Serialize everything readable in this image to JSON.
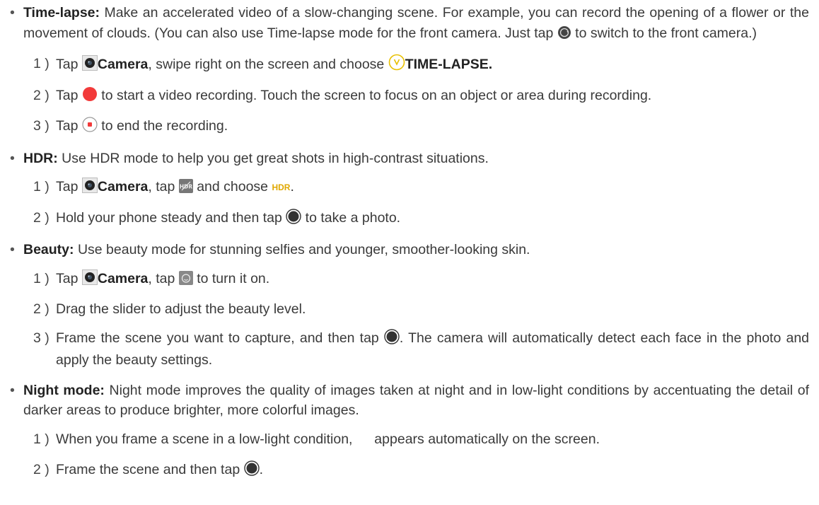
{
  "timelapse": {
    "lead": "Time-lapse:",
    "desc_1": " Make an accelerated video of a slow-changing scene. For example, you can record the opening of a flower or the movement of clouds. (You can also use Time-lapse mode for the front camera. Just tap ",
    "desc_2": " to switch to the front camera.)",
    "step1": {
      "num": "1 )",
      "a": "Tap ",
      "camera": "Camera",
      "b": ", swipe right on the screen and choose ",
      "mode": "TIME-LAPSE."
    },
    "step2": {
      "num": "2 )",
      "a": "Tap ",
      "b": " to start a video recording. Touch the screen to focus on an object or area during recording."
    },
    "step3": {
      "num": "3 )",
      "a": "Tap ",
      "b": " to end the recording."
    }
  },
  "hdr": {
    "lead": "HDR:",
    "desc": " Use HDR mode to help you get great shots in high-contrast situations.",
    "step1": {
      "num": "1 )",
      "a": "Tap ",
      "camera": "Camera",
      "b": ", tap ",
      "c": " and choose ",
      "label": "HDR",
      "d": "."
    },
    "step2": {
      "num": "2 )",
      "a": "Hold your phone steady and then tap ",
      "b": " to take a photo."
    }
  },
  "beauty": {
    "lead": "Beauty:",
    "desc": " Use beauty mode for stunning selfies and younger, smoother-looking skin.",
    "step1": {
      "num": "1 )",
      "a": "Tap ",
      "camera": "Camera",
      "b": ", tap ",
      "c": " to turn it on."
    },
    "step2": {
      "num": "2 )",
      "a": "Drag the slider to adjust the beauty level."
    },
    "step3": {
      "num": "3 )",
      "a": "Frame the scene you want to capture, and then tap ",
      "b": ". The camera will automatically detect each face in the photo and apply the beauty settings."
    }
  },
  "night": {
    "lead": "Night mode:",
    "desc": " Night mode improves the quality of images taken at night and in low-light conditions by accentuating the detail of darker areas to produce brighter, more colorful images.",
    "step1": {
      "num": "1 )",
      "a": "When you frame a scene in a low-light condition, ",
      "b": " appears automatically on the screen."
    },
    "step2": {
      "num": "2 )",
      "a": "Frame the scene and then tap ",
      "b": "."
    }
  },
  "bullet": "•",
  "colors": {
    "record_red": "#f23a3a",
    "hdr_yellow": "#e0a800",
    "timelapse_yellow": "#e8c000",
    "moon": "#f2b705"
  },
  "icons": [
    "switch-camera-icon",
    "camera-app-icon",
    "timelapse-icon",
    "record-button-icon",
    "stop-button-icon",
    "hdr-off-icon",
    "shutter-button-icon",
    "beauty-icon",
    "night-moon-icon"
  ]
}
